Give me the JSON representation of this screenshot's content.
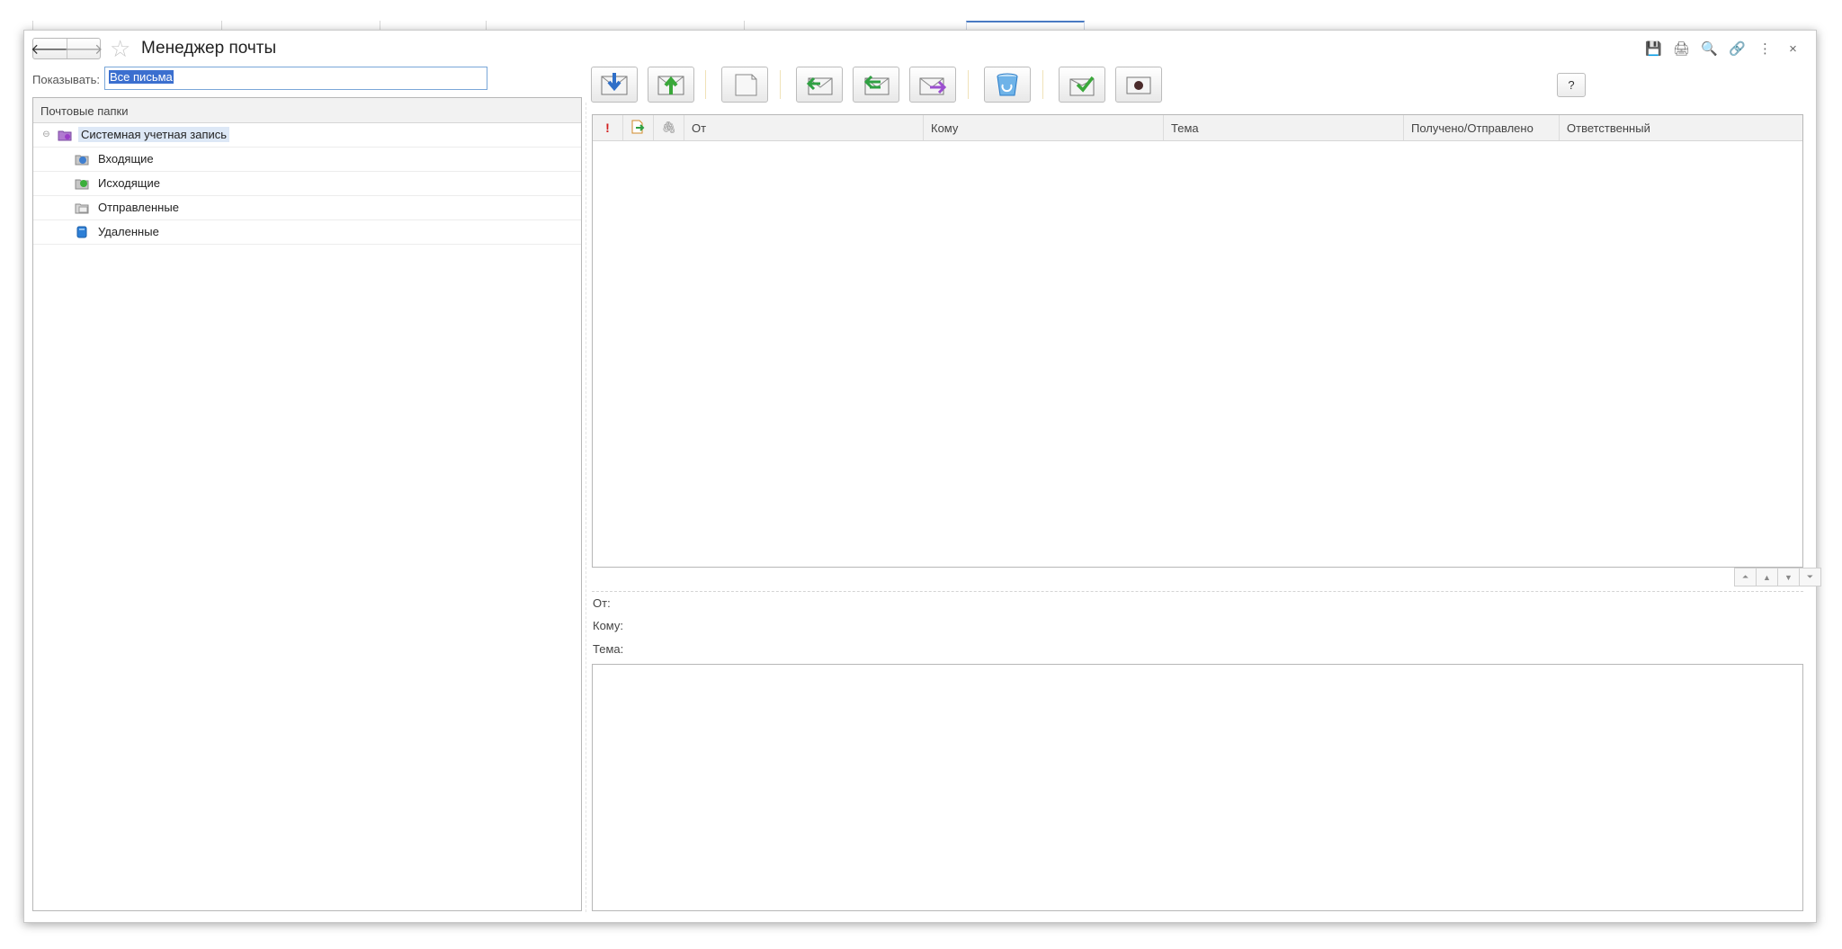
{
  "window": {
    "title": "Менеджер почты",
    "nav": {
      "back_icon": "arrow-left-icon",
      "forward_icon": "arrow-right-icon"
    },
    "favorite_icon": "star-icon",
    "tools": [
      "save-icon",
      "print-icon",
      "preview-icon",
      "link-icon",
      "more-vert-icon",
      "close-icon"
    ],
    "tool_glyphs": [
      "💾",
      "🖨",
      "🔍",
      "🔗",
      "⋮",
      "×"
    ]
  },
  "filter": {
    "label": "Показывать:",
    "value": "Все письма"
  },
  "folders": {
    "header": "Почтовые папки",
    "account": {
      "label": "Системная учетная запись",
      "expander": "⊖"
    },
    "items": [
      {
        "label": "Входящие",
        "icon": "inbox-folder-icon",
        "color": "#3f7fd0"
      },
      {
        "label": "Исходящие",
        "icon": "outbox-folder-icon",
        "color": "#3cae3c"
      },
      {
        "label": "Отправленные",
        "icon": "sent-folder-icon",
        "color": "#9a9a9a"
      },
      {
        "label": "Удаленные",
        "icon": "deleted-folder-icon",
        "color": "#2d7fd6"
      }
    ]
  },
  "toolbar": {
    "buttons": [
      {
        "name": "receive-mail-button",
        "icon": "download-mail-icon"
      },
      {
        "name": "send-mail-button",
        "icon": "upload-mail-icon"
      },
      {
        "name": "new-message-button",
        "icon": "new-message-icon"
      },
      {
        "name": "reply-button",
        "icon": "reply-icon"
      },
      {
        "name": "reply-all-button",
        "icon": "reply-all-icon"
      },
      {
        "name": "forward-button",
        "icon": "forward-icon"
      },
      {
        "name": "delete-button",
        "icon": "trash-icon"
      },
      {
        "name": "mark-read-button",
        "icon": "check-mail-icon"
      },
      {
        "name": "mark-button",
        "icon": "stop-mark-icon"
      }
    ],
    "help_label": "?"
  },
  "mail_list": {
    "columns": {
      "importance": "!",
      "from": "От",
      "to": "Кому",
      "subject": "Тема",
      "date": "Получено/Отправлено",
      "responsible": "Ответственный"
    }
  },
  "preview": {
    "from_label": "От:",
    "to_label": "Кому:",
    "subject_label": "Тема:"
  }
}
